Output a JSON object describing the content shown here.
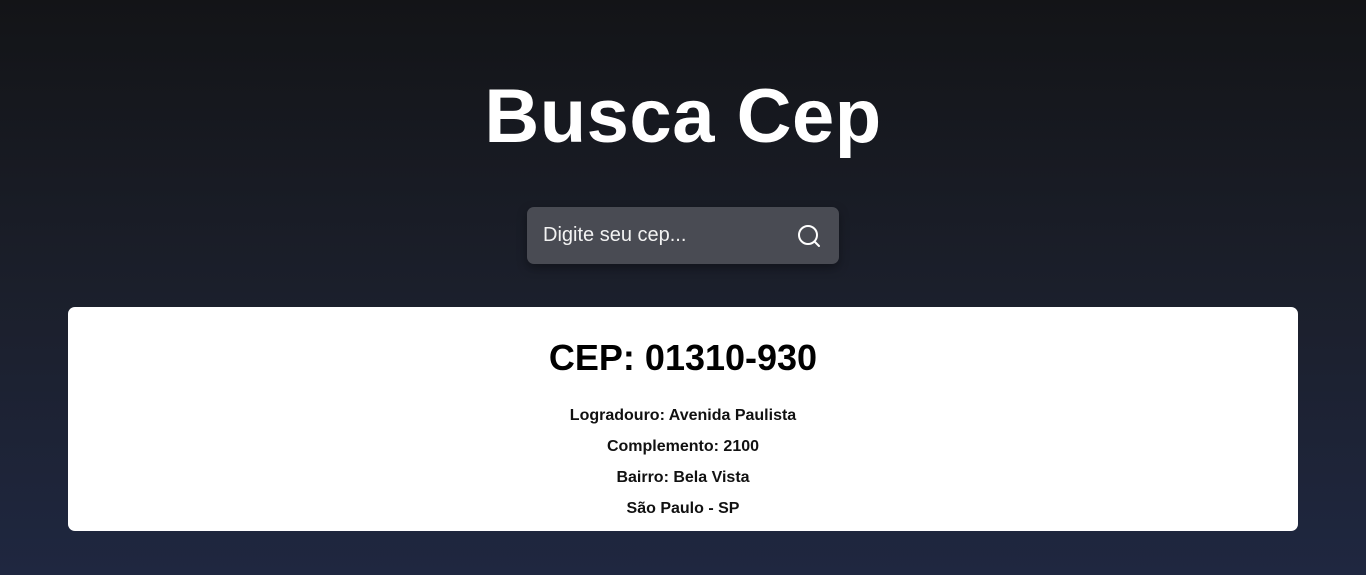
{
  "header": {
    "title": "Busca Cep"
  },
  "search": {
    "placeholder": "Digite seu cep...",
    "value": "",
    "button_icon": "search-icon"
  },
  "result": {
    "cep_label": "CEP: 01310-930",
    "logradouro": "Logradouro: Avenida Paulista",
    "complemento": "Complemento: 2100",
    "bairro": "Bairro: Bela Vista",
    "cidade_uf": "São Paulo - SP"
  },
  "colors": {
    "background_top": "#131417",
    "background_bottom": "#1f2740",
    "search_box": "#494b53",
    "card": "#ffffff",
    "title_text": "#ffffff"
  }
}
